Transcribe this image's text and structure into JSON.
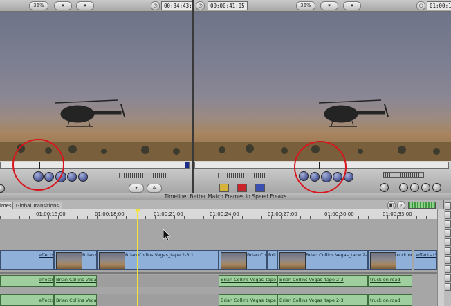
{
  "viewer": {
    "zoom": "36%",
    "timecode": "00:34:43:04"
  },
  "canvas": {
    "timecode_left": "00:00:41:05",
    "zoom": "36%",
    "timecode_right": "01:00:19:1"
  },
  "timeline": {
    "title": "Timeline: Better Match Frames in Speed Freaks",
    "tabs": [
      "rimes",
      "Global Transitions"
    ],
    "ruler": [
      "01:00:15;00",
      "01:00:18;00",
      "01:00:21;00",
      "01:00:24;00",
      "01:00:27;00",
      "01:00:30;00",
      "01:00:33;00"
    ],
    "video_clips": [
      {
        "label": "effects"
      },
      {
        "label": "Brian C"
      },
      {
        "label": "Brian Collins Vegas_tape 2-3 1"
      },
      {
        "label": "Brian Colli"
      },
      {
        "label": "Brit"
      },
      {
        "label": "Brian Collins Vegas_tape 2-3"
      },
      {
        "label": "truck on"
      },
      {
        "label": "effects (50"
      }
    ],
    "audio1_clips": [
      {
        "label": "effects"
      },
      {
        "label": "Brian Collins Vegas_t"
      },
      {
        "label": "Brian Collins Vegas_tape 1-9"
      },
      {
        "label": "Brian Collins Vegas_tape 2-3"
      },
      {
        "label": "truck on road"
      }
    ],
    "audio2_clips": [
      {
        "label": "effects"
      },
      {
        "label": "Brian Collins Vegas_t"
      },
      {
        "label": "Brian Collins Vegas_tape 1-9"
      },
      {
        "label": "Brian Collins Vegas_tape 2-3"
      },
      {
        "label": "truck on road"
      }
    ]
  },
  "colors": {
    "highlight_circle": "#d8141c",
    "playhead": "#f4e23a",
    "video_clip": "#8fb0d8",
    "audio_clip": "#9fcf9f"
  },
  "icons": [
    "play-icon",
    "mark-in-icon",
    "mark-out-icon",
    "cursor-arrow-icon",
    "helicopter-frame"
  ]
}
